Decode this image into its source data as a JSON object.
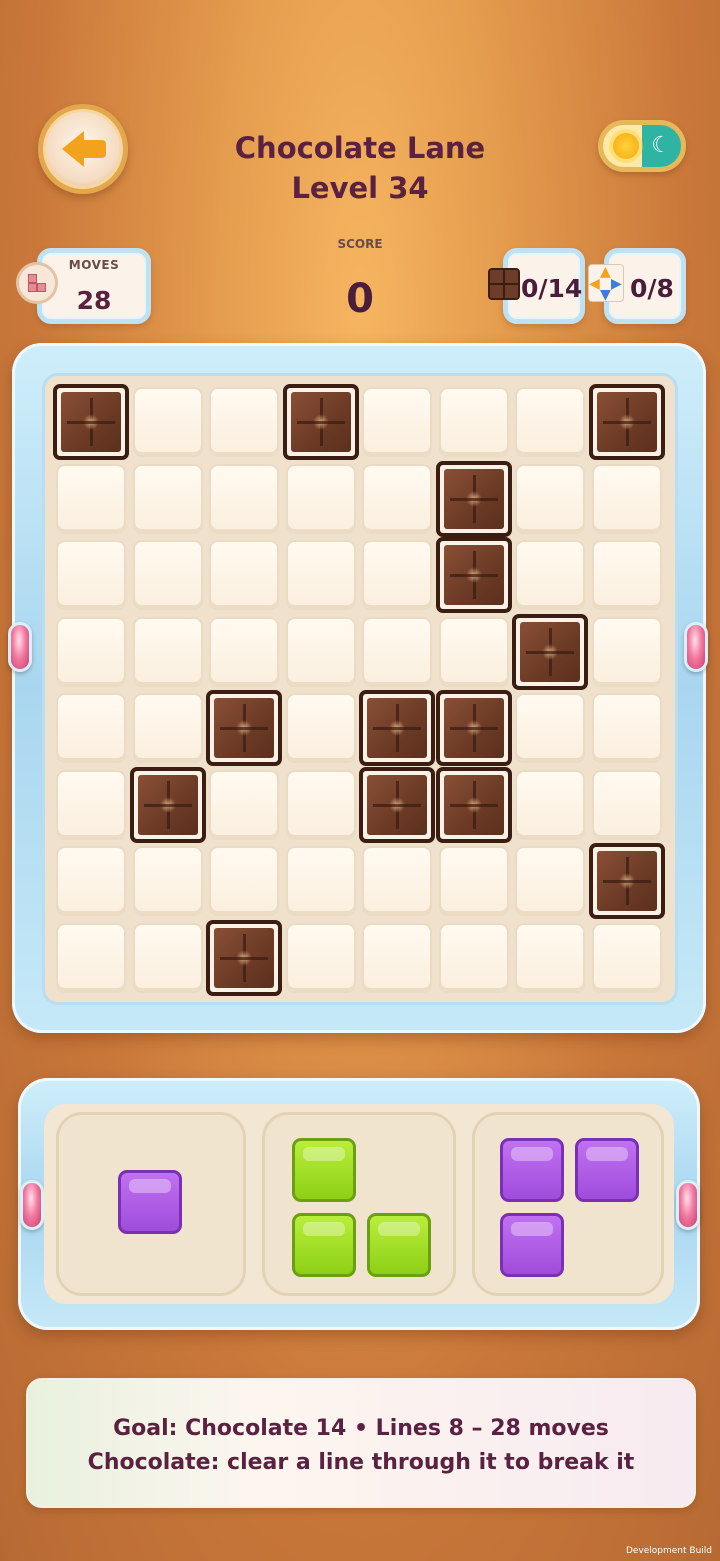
{
  "header": {
    "title_line1": "Chocolate Lane",
    "title_line2": "Level 34"
  },
  "stats": {
    "moves_label": "MOVES",
    "moves_value": "28",
    "score_label": "SCORE",
    "score_value": "0",
    "chocolate_goal": "0/14",
    "lines_goal": "0/8"
  },
  "board": {
    "rows": 8,
    "cols": 8,
    "chocolate_cells": [
      [
        0,
        0
      ],
      [
        0,
        3
      ],
      [
        0,
        7
      ],
      [
        1,
        5
      ],
      [
        2,
        5
      ],
      [
        3,
        6
      ],
      [
        4,
        2
      ],
      [
        4,
        4
      ],
      [
        4,
        5
      ],
      [
        5,
        1
      ],
      [
        5,
        4
      ],
      [
        5,
        5
      ],
      [
        6,
        7
      ],
      [
        7,
        2
      ]
    ]
  },
  "tray": {
    "pieces": [
      {
        "color": "purple",
        "cells": [
          [
            0,
            0
          ]
        ]
      },
      {
        "color": "green",
        "cells": [
          [
            0,
            0
          ],
          [
            1,
            0
          ],
          [
            1,
            1
          ]
        ]
      },
      {
        "color": "purple",
        "cells": [
          [
            0,
            0
          ],
          [
            0,
            1
          ],
          [
            1,
            0
          ]
        ]
      }
    ]
  },
  "goal_banner": {
    "line1": "Goal: Chocolate 14  •  Lines 8   –   28 moves",
    "line2": "Chocolate: clear a line through it to break it"
  },
  "footer": {
    "dev_build": "Development Build"
  },
  "colors": {
    "title": "#5a2140",
    "chocolate": "#6b3a25",
    "purple_block": "#a04cdc",
    "green_block": "#8ed016"
  }
}
